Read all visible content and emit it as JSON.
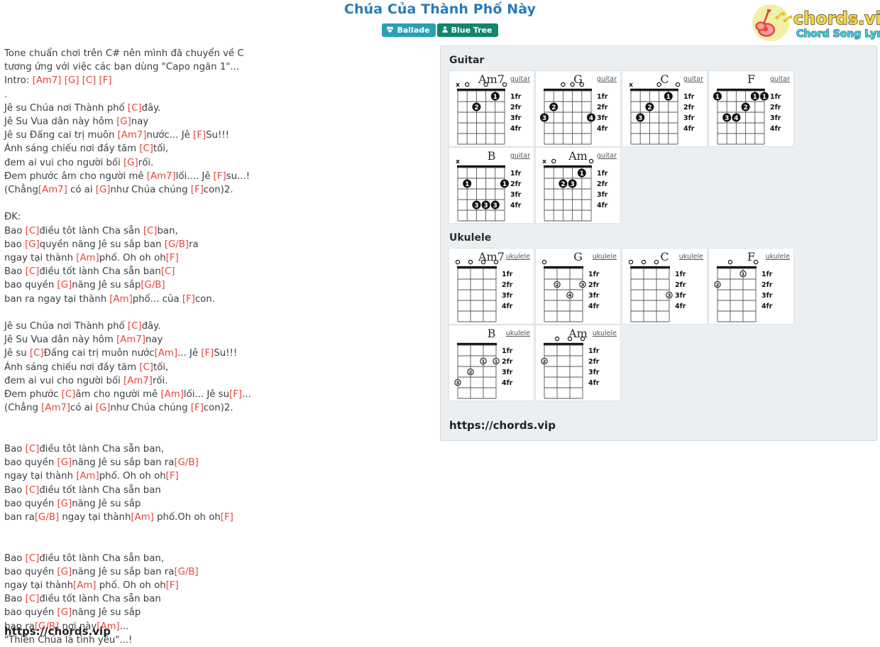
{
  "header": {
    "title": "Chúa Của Thành Phố Này",
    "badges": [
      {
        "label": "Ballade",
        "icon": "heartbeat-icon",
        "color": "#28a0b5"
      },
      {
        "label": "Blue Tree",
        "icon": "person-icon",
        "color": "#12856f"
      }
    ],
    "logo": {
      "main_text": "chords.vip",
      "sub_text": "Chord Song Lyric",
      "main_color": "#f5d547",
      "sub_color": "#3fd0e0",
      "circle_color": "#f2f0a8",
      "guitar_color": "#e8453c"
    }
  },
  "lyrics": {
    "chord_color": "#e8453c",
    "footer_link": "https://chords.vip",
    "lines": [
      [
        {
          "t": "Tone chuẩn chơi trên C# nên mình đã chuyển về C"
        }
      ],
      [
        {
          "t": "tương ứng với việc các bạn dùng \"Capo ngăn 1\"..."
        }
      ],
      [
        {
          "t": "Intro: "
        },
        {
          "c": "[Am7]"
        },
        {
          "t": " "
        },
        {
          "c": "[G]"
        },
        {
          "t": " "
        },
        {
          "c": "[C]"
        },
        {
          "t": " "
        },
        {
          "c": "[F]"
        }
      ],
      [
        {
          "t": "."
        }
      ],
      [
        {
          "t": "Jê su Chúa nơi Thành phố "
        },
        {
          "c": "[C]"
        },
        {
          "t": "đây."
        }
      ],
      [
        {
          "t": "Jê Su Vua dân này hôm "
        },
        {
          "c": "[G]"
        },
        {
          "t": "nay"
        }
      ],
      [
        {
          "t": "Jê su Đấng cai trị muôn "
        },
        {
          "c": "[Am7]"
        },
        {
          "t": "nước... Jê "
        },
        {
          "c": "[F]"
        },
        {
          "t": "Su!!!"
        }
      ],
      [
        {
          "t": "Ánh sáng chiếu nơi đầy tăm "
        },
        {
          "c": "[C]"
        },
        {
          "t": "tối,"
        }
      ],
      [
        {
          "t": "đem ai vui cho người bối "
        },
        {
          "c": "[G]"
        },
        {
          "t": "rối."
        }
      ],
      [
        {
          "t": "Đem phước âm cho người mê "
        },
        {
          "c": "[Am7]"
        },
        {
          "t": "lối.... Jê "
        },
        {
          "c": "[F]"
        },
        {
          "t": "su...!"
        }
      ],
      [
        {
          "t": "(Chẳng"
        },
        {
          "c": "[Am7]"
        },
        {
          "t": " có ai "
        },
        {
          "c": "[G]"
        },
        {
          "t": "như Chúa chúng "
        },
        {
          "c": "[F]"
        },
        {
          "t": "con)2."
        }
      ],
      [
        {
          "t": ""
        }
      ],
      [
        {
          "t": "ĐK:"
        }
      ],
      [
        {
          "t": "Bao "
        },
        {
          "c": "[C]"
        },
        {
          "t": "điều tôt lành Cha sẵn "
        },
        {
          "c": "[C]"
        },
        {
          "t": "ban,"
        }
      ],
      [
        {
          "t": "bao "
        },
        {
          "c": "[G]"
        },
        {
          "t": "quyền năng Jê su sắp ban "
        },
        {
          "c": "[G/B]"
        },
        {
          "t": "ra"
        }
      ],
      [
        {
          "t": "ngay tại thành "
        },
        {
          "c": "[Am]"
        },
        {
          "t": "phố. Oh oh oh"
        },
        {
          "c": "[F]"
        }
      ],
      [
        {
          "t": "Bao "
        },
        {
          "c": "[C]"
        },
        {
          "t": "điều tốt lành Cha sẵn ban"
        },
        {
          "c": "[C]"
        }
      ],
      [
        {
          "t": "bao quyền "
        },
        {
          "c": "[G]"
        },
        {
          "t": "năng Jê su sắp"
        },
        {
          "c": "[G/B]"
        }
      ],
      [
        {
          "t": "ban ra ngay tại thành "
        },
        {
          "c": "[Am]"
        },
        {
          "t": "phố... của "
        },
        {
          "c": "[F]"
        },
        {
          "t": "con."
        }
      ],
      [
        {
          "t": ""
        }
      ],
      [
        {
          "t": "Jê su Chúa nơi Thành phố "
        },
        {
          "c": "[C]"
        },
        {
          "t": "đây."
        }
      ],
      [
        {
          "t": "Jê Su Vua dân này hôm "
        },
        {
          "c": "[Am7]"
        },
        {
          "t": "nay"
        }
      ],
      [
        {
          "t": "Jê su "
        },
        {
          "c": "[C]"
        },
        {
          "t": "Đấng cai trị muôn nước"
        },
        {
          "c": "[Am]"
        },
        {
          "t": "... Jê "
        },
        {
          "c": "[F]"
        },
        {
          "t": "Su!!!"
        }
      ],
      [
        {
          "t": "Ánh sáng chiếu nơi đầy tăm "
        },
        {
          "c": "[C]"
        },
        {
          "t": "tối,"
        }
      ],
      [
        {
          "t": "đem ai vui cho người bối "
        },
        {
          "c": "[Am7]"
        },
        {
          "t": "rối."
        }
      ],
      [
        {
          "t": "Đem phước "
        },
        {
          "c": "[C]"
        },
        {
          "t": "âm cho người mê "
        },
        {
          "c": "[Am]"
        },
        {
          "t": "lối... Jê su"
        },
        {
          "c": "[F]"
        },
        {
          "t": "..."
        }
      ],
      [
        {
          "t": "(Chẳng "
        },
        {
          "c": "[Am7]"
        },
        {
          "t": "có ai "
        },
        {
          "c": "[G]"
        },
        {
          "t": "như Chúa chúng "
        },
        {
          "c": "[F]"
        },
        {
          "t": "con)2."
        }
      ],
      [
        {
          "t": ""
        }
      ],
      [
        {
          "t": ""
        }
      ],
      [
        {
          "t": "Bao "
        },
        {
          "c": "[C]"
        },
        {
          "t": "điều tôt lành Cha sẵn ban,"
        }
      ],
      [
        {
          "t": "bao quyền "
        },
        {
          "c": "[G]"
        },
        {
          "t": "năng Jê su sắp ban ra"
        },
        {
          "c": "[G/B]"
        }
      ],
      [
        {
          "t": "ngay tại thành "
        },
        {
          "c": "[Am]"
        },
        {
          "t": "phố. Oh oh oh"
        },
        {
          "c": "[F]"
        }
      ],
      [
        {
          "t": "Bao "
        },
        {
          "c": "[C]"
        },
        {
          "t": "điều tốt lành Cha sẵn ban"
        }
      ],
      [
        {
          "t": "bao quyền "
        },
        {
          "c": "[G]"
        },
        {
          "t": "năng Jê su sắp"
        }
      ],
      [
        {
          "t": "ban ra"
        },
        {
          "c": "[G/B]"
        },
        {
          "t": " ngay tại thành"
        },
        {
          "c": "[Am]"
        },
        {
          "t": " phố.Oh oh oh"
        },
        {
          "c": "[F]"
        }
      ],
      [
        {
          "t": ""
        }
      ],
      [
        {
          "t": ""
        }
      ],
      [
        {
          "t": "Bao "
        },
        {
          "c": "[C]"
        },
        {
          "t": "điều tôt lành Cha sẵn ban,"
        }
      ],
      [
        {
          "t": "bao quyền "
        },
        {
          "c": "[G]"
        },
        {
          "t": "năng Jê su sắp ban ra"
        },
        {
          "c": "[G/B]"
        }
      ],
      [
        {
          "t": "ngay tại thành"
        },
        {
          "c": "[Am]"
        },
        {
          "t": " phố. Oh oh oh"
        },
        {
          "c": "[F]"
        }
      ],
      [
        {
          "t": "Bao "
        },
        {
          "c": "[C]"
        },
        {
          "t": "điều tốt lành Cha sẵn ban"
        }
      ],
      [
        {
          "t": "bao quyền "
        },
        {
          "c": "[G]"
        },
        {
          "t": "năng Jê su sắp"
        }
      ],
      [
        {
          "t": "ban ra"
        },
        {
          "c": "[G/B]"
        },
        {
          "t": " nơi này"
        },
        {
          "c": "[Am]"
        },
        {
          "t": "..."
        }
      ],
      [
        {
          "t": "\"Thiên Chúa là tình yêu\"...!"
        }
      ]
    ]
  },
  "chord_panel": {
    "guitar_heading": "Guitar",
    "ukulele_heading": "Ukulele",
    "link": "https://chords.vip",
    "fret_labels": [
      "1fr",
      "2fr",
      "3fr",
      "4fr"
    ],
    "guitar": [
      {
        "name": "Am7",
        "inst": "guitar",
        "strings": 6,
        "open": [
          "x",
          "o",
          "",
          "o",
          "",
          "o"
        ],
        "dots": [
          {
            "s": 5,
            "f": 1,
            "n": "1"
          },
          {
            "s": 3,
            "f": 2,
            "n": "2"
          }
        ]
      },
      {
        "name": "G",
        "inst": "guitar",
        "strings": 6,
        "open": [
          "",
          "",
          "o",
          "o",
          "o",
          ""
        ],
        "dots": [
          {
            "s": 2,
            "f": 2,
            "n": "2"
          },
          {
            "s": 1,
            "f": 3,
            "n": "3"
          },
          {
            "s": 6,
            "f": 3,
            "n": "4"
          }
        ]
      },
      {
        "name": "C",
        "inst": "guitar",
        "strings": 6,
        "open": [
          "x",
          "",
          "",
          "o",
          "",
          "o"
        ],
        "dots": [
          {
            "s": 5,
            "f": 1,
            "n": "1"
          },
          {
            "s": 3,
            "f": 2,
            "n": "2"
          },
          {
            "s": 2,
            "f": 3,
            "n": "3"
          }
        ]
      },
      {
        "name": "F",
        "inst": "guitar",
        "strings": 6,
        "open": [
          "",
          "",
          "",
          "",
          "",
          ""
        ],
        "dots": [
          {
            "s": 1,
            "f": 1,
            "n": "1"
          },
          {
            "s": 5,
            "f": 1,
            "n": "1"
          },
          {
            "s": 6,
            "f": 1,
            "n": "1"
          },
          {
            "s": 4,
            "f": 2,
            "n": "2"
          },
          {
            "s": 2,
            "f": 3,
            "n": "3"
          },
          {
            "s": 3,
            "f": 3,
            "n": "4"
          }
        ]
      },
      {
        "name": "B",
        "inst": "guitar",
        "strings": 6,
        "open": [
          "x",
          "",
          "",
          "",
          "",
          ""
        ],
        "dots": [
          {
            "s": 2,
            "f": 2,
            "n": "1"
          },
          {
            "s": 6,
            "f": 2,
            "n": "1"
          },
          {
            "s": 3,
            "f": 4,
            "n": "3"
          },
          {
            "s": 4,
            "f": 4,
            "n": "3"
          },
          {
            "s": 5,
            "f": 4,
            "n": "3"
          }
        ]
      },
      {
        "name": "Am",
        "inst": "guitar",
        "strings": 6,
        "open": [
          "x",
          "o",
          "",
          "",
          "",
          "o"
        ],
        "dots": [
          {
            "s": 5,
            "f": 1,
            "n": "1"
          },
          {
            "s": 3,
            "f": 2,
            "n": "2"
          },
          {
            "s": 4,
            "f": 2,
            "n": "3"
          }
        ]
      }
    ],
    "ukulele": [
      {
        "name": "Am7",
        "inst": "ukulele",
        "strings": 4,
        "open": [
          "o",
          "o",
          "o",
          "o"
        ],
        "dots": []
      },
      {
        "name": "G",
        "inst": "ukulele",
        "strings": 4,
        "open": [
          "o",
          "",
          "",
          ""
        ],
        "dots": [
          {
            "s": 2,
            "f": 2,
            "n": "2"
          },
          {
            "s": 4,
            "f": 2,
            "n": "3"
          },
          {
            "s": 3,
            "f": 3,
            "n": "4"
          }
        ]
      },
      {
        "name": "C",
        "inst": "ukulele",
        "strings": 4,
        "open": [
          "o",
          "o",
          "o",
          ""
        ],
        "dots": [
          {
            "s": 4,
            "f": 3,
            "n": "3"
          }
        ]
      },
      {
        "name": "F",
        "inst": "ukulele",
        "strings": 4,
        "open": [
          "",
          "o",
          "",
          "o"
        ],
        "dots": [
          {
            "s": 3,
            "f": 1,
            "n": "1"
          },
          {
            "s": 1,
            "f": 2,
            "n": "2"
          }
        ]
      },
      {
        "name": "B",
        "inst": "ukulele",
        "strings": 4,
        "open": [
          "",
          "",
          "",
          ""
        ],
        "dots": [
          {
            "s": 3,
            "f": 2,
            "n": "1"
          },
          {
            "s": 4,
            "f": 2,
            "n": "1"
          },
          {
            "s": 2,
            "f": 3,
            "n": "2"
          },
          {
            "s": 1,
            "f": 4,
            "n": "3"
          }
        ]
      },
      {
        "name": "Am",
        "inst": "ukulele",
        "strings": 4,
        "open": [
          "",
          "o",
          "o",
          "o"
        ],
        "dots": [
          {
            "s": 1,
            "f": 2,
            "n": "2"
          }
        ]
      }
    ]
  }
}
